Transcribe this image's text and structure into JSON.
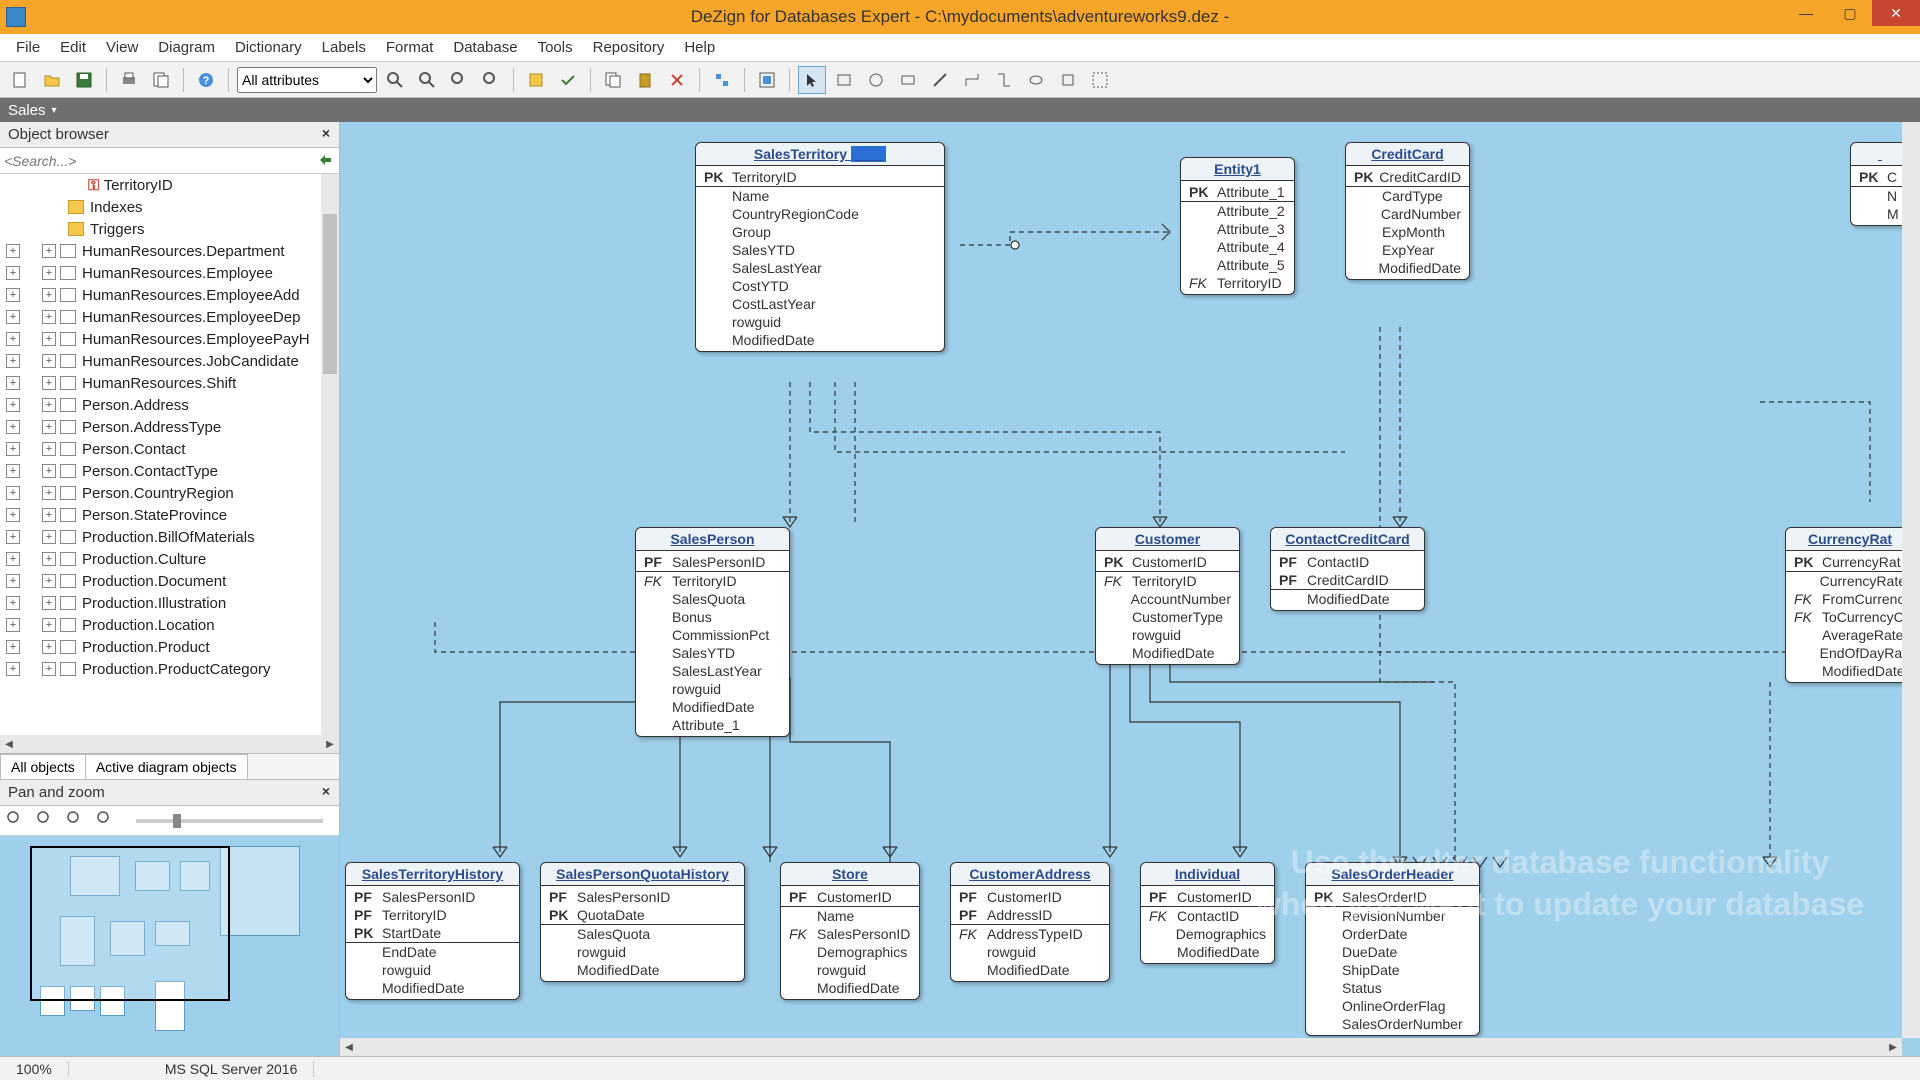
{
  "title": "DeZign for Databases Expert - C:\\mydocuments\\adventureworks9.dez -",
  "menus": [
    "File",
    "Edit",
    "View",
    "Diagram",
    "Dictionary",
    "Labels",
    "Format",
    "Database",
    "Tools",
    "Repository",
    "Help"
  ],
  "toolbar_combo": "All attributes",
  "diagram_tab": "Sales",
  "object_browser": {
    "title": "Object browser",
    "search_placeholder": "<Search...>",
    "territory": "TerritoryID",
    "indexes": "Indexes",
    "triggers": "Triggers",
    "items": [
      "HumanResources.Department",
      "HumanResources.Employee",
      "HumanResources.EmployeeAdd",
      "HumanResources.EmployeeDep",
      "HumanResources.EmployeePayH",
      "HumanResources.JobCandidate",
      "HumanResources.Shift",
      "Person.Address",
      "Person.AddressType",
      "Person.Contact",
      "Person.ContactType",
      "Person.CountryRegion",
      "Person.StateProvince",
      "Production.BillOfMaterials",
      "Production.Culture",
      "Production.Document",
      "Production.Illustration",
      "Production.Location",
      "Production.Product",
      "Production.ProductCategory"
    ],
    "bottom_tabs": [
      "All objects",
      "Active diagram objects"
    ]
  },
  "panzoom_title": "Pan and zoom",
  "entities": {
    "salesTerritory": {
      "title": "SalesTerritory",
      "attrs": [
        {
          "k": "PK",
          "n": "TerritoryID"
        },
        {
          "k": "",
          "n": "Name"
        },
        {
          "k": "",
          "n": "CountryRegionCode"
        },
        {
          "k": "",
          "n": "Group"
        },
        {
          "k": "",
          "n": "SalesYTD"
        },
        {
          "k": "",
          "n": "SalesLastYear"
        },
        {
          "k": "",
          "n": "CostYTD"
        },
        {
          "k": "",
          "n": "CostLastYear"
        },
        {
          "k": "",
          "n": "rowguid"
        },
        {
          "k": "",
          "n": "ModifiedDate"
        }
      ]
    },
    "entity1": {
      "title": "Entity1",
      "attrs": [
        {
          "k": "PK",
          "n": "Attribute_1"
        },
        {
          "k": "",
          "n": "Attribute_2"
        },
        {
          "k": "",
          "n": "Attribute_3"
        },
        {
          "k": "",
          "n": "Attribute_4"
        },
        {
          "k": "",
          "n": "Attribute_5"
        },
        {
          "k": "FK",
          "n": "TerritoryID"
        }
      ]
    },
    "creditCard": {
      "title": "CreditCard",
      "attrs": [
        {
          "k": "PK",
          "n": "CreditCardID"
        },
        {
          "k": "",
          "n": "CardType"
        },
        {
          "k": "",
          "n": "CardNumber"
        },
        {
          "k": "",
          "n": "ExpMonth"
        },
        {
          "k": "",
          "n": "ExpYear"
        },
        {
          "k": "",
          "n": "ModifiedDate"
        }
      ]
    },
    "salesPerson": {
      "title": "SalesPerson",
      "attrs": [
        {
          "k": "PF",
          "n": "SalesPersonID"
        },
        {
          "k": "FK",
          "n": "TerritoryID"
        },
        {
          "k": "",
          "n": "SalesQuota"
        },
        {
          "k": "",
          "n": "Bonus"
        },
        {
          "k": "",
          "n": "CommissionPct"
        },
        {
          "k": "",
          "n": "SalesYTD"
        },
        {
          "k": "",
          "n": "SalesLastYear"
        },
        {
          "k": "",
          "n": "rowguid"
        },
        {
          "k": "",
          "n": "ModifiedDate"
        },
        {
          "k": "",
          "n": "Attribute_1"
        }
      ]
    },
    "customer": {
      "title": "Customer",
      "attrs": [
        {
          "k": "PK",
          "n": "CustomerID"
        },
        {
          "k": "FK",
          "n": "TerritoryID"
        },
        {
          "k": "",
          "n": "AccountNumber"
        },
        {
          "k": "",
          "n": "CustomerType"
        },
        {
          "k": "",
          "n": "rowguid"
        },
        {
          "k": "",
          "n": "ModifiedDate"
        }
      ]
    },
    "contactCreditCard": {
      "title": "ContactCreditCard",
      "attrs": [
        {
          "k": "PF",
          "n": "ContactID"
        },
        {
          "k": "PF",
          "n": "CreditCardID"
        },
        {
          "k": "",
          "n": "ModifiedDate"
        }
      ]
    },
    "currencyRate": {
      "title": "CurrencyRat",
      "attrs": [
        {
          "k": "PK",
          "n": "CurrencyRat"
        },
        {
          "k": "",
          "n": "CurrencyRate"
        },
        {
          "k": "FK",
          "n": "FromCurrenc"
        },
        {
          "k": "FK",
          "n": "ToCurrencyC"
        },
        {
          "k": "",
          "n": "AverageRate"
        },
        {
          "k": "",
          "n": "EndOfDayRat"
        },
        {
          "k": "",
          "n": "ModifiedDate"
        }
      ]
    },
    "salesTerritoryHistory": {
      "title": "SalesTerritoryHistory",
      "attrs": [
        {
          "k": "PF",
          "n": "SalesPersonID"
        },
        {
          "k": "PF",
          "n": "TerritoryID"
        },
        {
          "k": "PK",
          "n": "StartDate"
        },
        {
          "k": "",
          "n": "EndDate"
        },
        {
          "k": "",
          "n": "rowguid"
        },
        {
          "k": "",
          "n": "ModifiedDate"
        }
      ]
    },
    "salesPersonQuotaHistory": {
      "title": "SalesPersonQuotaHistory",
      "attrs": [
        {
          "k": "PF",
          "n": "SalesPersonID"
        },
        {
          "k": "PK",
          "n": "QuotaDate"
        },
        {
          "k": "",
          "n": "SalesQuota"
        },
        {
          "k": "",
          "n": "rowguid"
        },
        {
          "k": "",
          "n": "ModifiedDate"
        }
      ]
    },
    "store": {
      "title": "Store",
      "attrs": [
        {
          "k": "PF",
          "n": "CustomerID"
        },
        {
          "k": "",
          "n": "Name"
        },
        {
          "k": "FK",
          "n": "SalesPersonID"
        },
        {
          "k": "",
          "n": "Demographics"
        },
        {
          "k": "",
          "n": "rowguid"
        },
        {
          "k": "",
          "n": "ModifiedDate"
        }
      ]
    },
    "customerAddress": {
      "title": "CustomerAddress",
      "attrs": [
        {
          "k": "PF",
          "n": "CustomerID"
        },
        {
          "k": "PF",
          "n": "AddressID"
        },
        {
          "k": "FK",
          "n": "AddressTypeID"
        },
        {
          "k": "",
          "n": "rowguid"
        },
        {
          "k": "",
          "n": "ModifiedDate"
        }
      ]
    },
    "individual": {
      "title": "Individual",
      "attrs": [
        {
          "k": "PF",
          "n": "CustomerID"
        },
        {
          "k": "FK",
          "n": "ContactID"
        },
        {
          "k": "",
          "n": "Demographics"
        },
        {
          "k": "",
          "n": "ModifiedDate"
        }
      ]
    },
    "salesOrderHeader": {
      "title": "SalesOrderHeader",
      "attrs": [
        {
          "k": "PK",
          "n": "SalesOrderID"
        },
        {
          "k": "",
          "n": "RevisionNumber"
        },
        {
          "k": "",
          "n": "OrderDate"
        },
        {
          "k": "",
          "n": "DueDate"
        },
        {
          "k": "",
          "n": "ShipDate"
        },
        {
          "k": "",
          "n": "Status"
        },
        {
          "k": "",
          "n": "OnlineOrderFlag"
        },
        {
          "k": "",
          "n": "SalesOrderNumber"
        }
      ]
    },
    "clipped": {
      "attrs": [
        {
          "k": "PK",
          "n": "C"
        },
        {
          "k": "",
          "n": "N"
        },
        {
          "k": "",
          "n": "M"
        }
      ]
    }
  },
  "watermark": "Use the alter database functionality\nwhen you want to update your\ndatabase",
  "status": {
    "zoom": "100%",
    "db": "MS SQL Server 2016"
  }
}
